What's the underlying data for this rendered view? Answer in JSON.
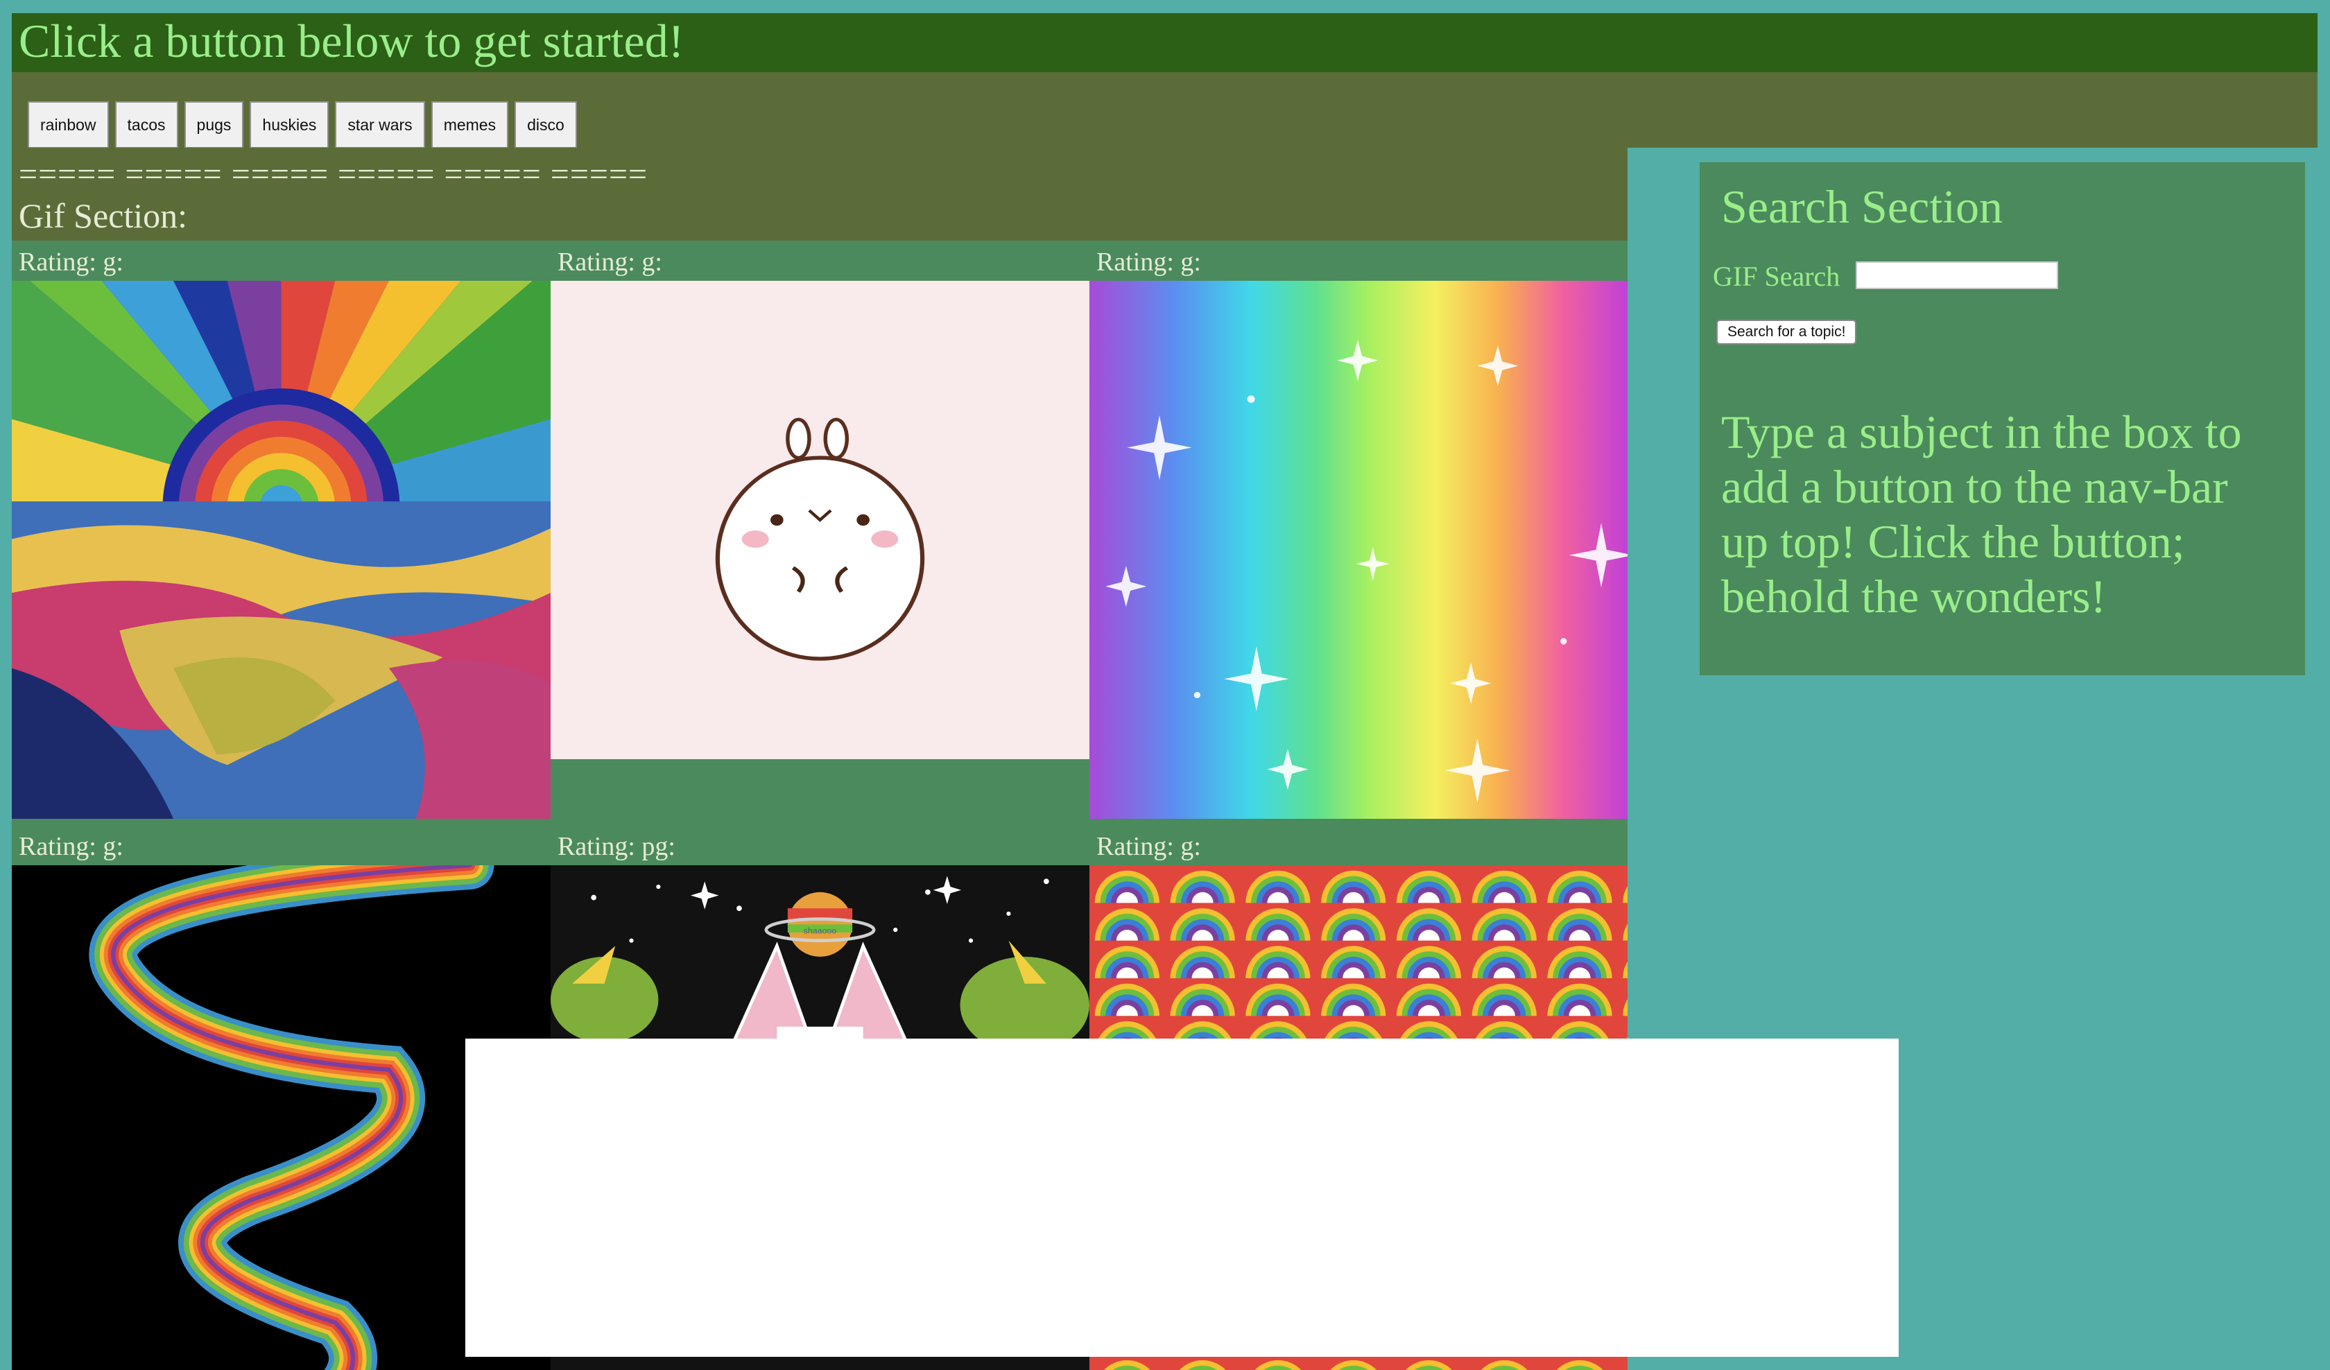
{
  "header": {
    "title": "Click a button below to get started!"
  },
  "nav": {
    "buttons": [
      "rainbow",
      "tacos",
      "pugs",
      "huskies",
      "star wars",
      "memes",
      "disco"
    ]
  },
  "gif_section": {
    "divider": "===== ===== ===== ===== ===== =====",
    "title": "Gif Section:",
    "ratings": [
      "Rating: g:",
      "Rating: g:",
      "Rating: g:",
      "Rating: g:",
      "Rating: pg:",
      "Rating: g:"
    ]
  },
  "search": {
    "title": "Search Section",
    "label": "GIF Search",
    "input_value": "",
    "button_label": "Search for a topic!",
    "help_text": "Type a subject in the box to add a button to the nav-bar up top! Click the button; behold the wonders!"
  },
  "gif_art_text": {
    "planet_label": "shaaooo"
  }
}
